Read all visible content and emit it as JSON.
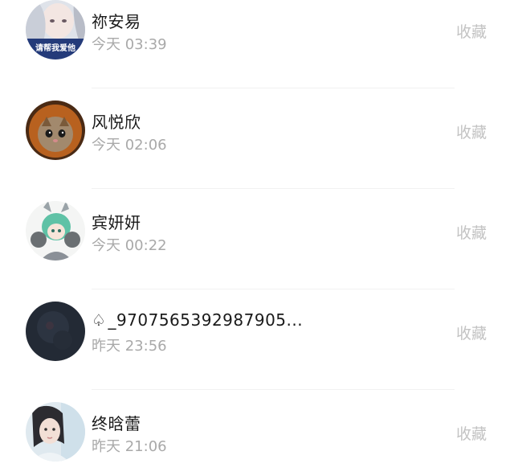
{
  "favorite_label": "收藏",
  "users": [
    {
      "name": "祢安易",
      "time": "今天 03:39",
      "avatar_icon": "girl-avatar-with-text"
    },
    {
      "name": "风悦欣",
      "time": "今天 02:06",
      "avatar_icon": "kitten-in-bear-hat-avatar"
    },
    {
      "name": "宾妍妍",
      "time": "今天 00:22",
      "avatar_icon": "anime-girl-with-headphones-avatar"
    },
    {
      "name": "_9707565392987905...",
      "name_prefix_icon": "spade-outline-icon",
      "time": "昨天 23:56",
      "avatar_icon": "dark-avatar"
    },
    {
      "name": "终晗蕾",
      "time": "昨天 21:06",
      "avatar_icon": "girl-portrait-avatar"
    }
  ]
}
